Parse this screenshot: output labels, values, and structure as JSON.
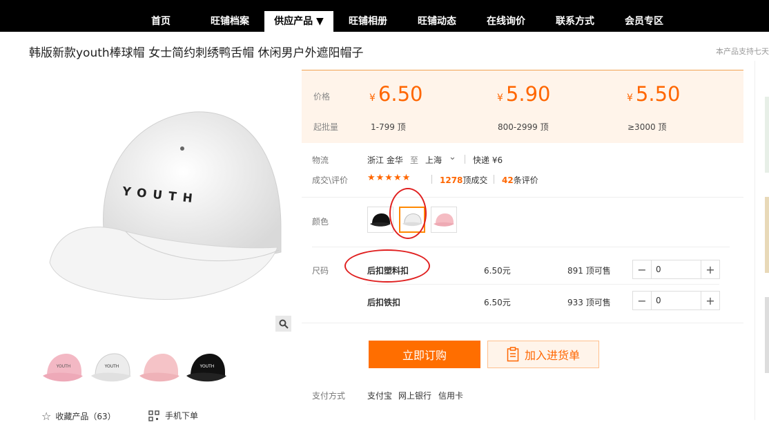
{
  "nav": {
    "items": [
      {
        "label": "首页"
      },
      {
        "label": "旺铺档案"
      },
      {
        "label": "供应产品 ▼"
      },
      {
        "label": "旺铺相册"
      },
      {
        "label": "旺铺动态"
      },
      {
        "label": "在线询价"
      },
      {
        "label": "联系方式"
      },
      {
        "label": "会员专区"
      }
    ]
  },
  "product": {
    "title": "韩版新款youth棒球帽 女士简约刺绣鸭舌帽 休闲男户外遮阳帽子",
    "note": "本产品支持七天",
    "cap_text": "YOUTH"
  },
  "price": {
    "label": "价格",
    "batch_label": "起批量",
    "currency": "¥",
    "tiers": [
      {
        "price": "6.50",
        "range": "1-799 顶"
      },
      {
        "price": "5.90",
        "range": "800-2999 顶"
      },
      {
        "price": "5.50",
        "range": "≥3000 顶"
      }
    ]
  },
  "logistics": {
    "label": "物流",
    "from": "浙江 金华",
    "to_word": "至",
    "to": "上海",
    "express": "快递 ¥6"
  },
  "deals": {
    "label": "成交\\评价",
    "stars": "★★★★★",
    "count": "1278",
    "count_suffix": "顶成交",
    "reviews": "42",
    "reviews_suffix": "条评价"
  },
  "color": {
    "label": "颜色"
  },
  "size": {
    "label": "尺码",
    "rows": [
      {
        "name": "后扣塑料扣",
        "price": "6.50元",
        "stock": "891 顶可售",
        "qty": "0"
      },
      {
        "name": "后扣铁扣",
        "price": "6.50元",
        "stock": "933 顶可售",
        "qty": "0"
      }
    ]
  },
  "actions": {
    "buy": "立即订购",
    "cart": "加入进货单"
  },
  "payment": {
    "label": "支付方式",
    "methods": [
      "支付宝",
      "网上银行",
      "信用卡"
    ]
  },
  "footer": {
    "favorite": "收藏产品（63）",
    "mobile": "手机下单"
  },
  "colors": {
    "accent": "#ff6600",
    "nav_bg": "#000000",
    "annotation": "#e02020"
  }
}
